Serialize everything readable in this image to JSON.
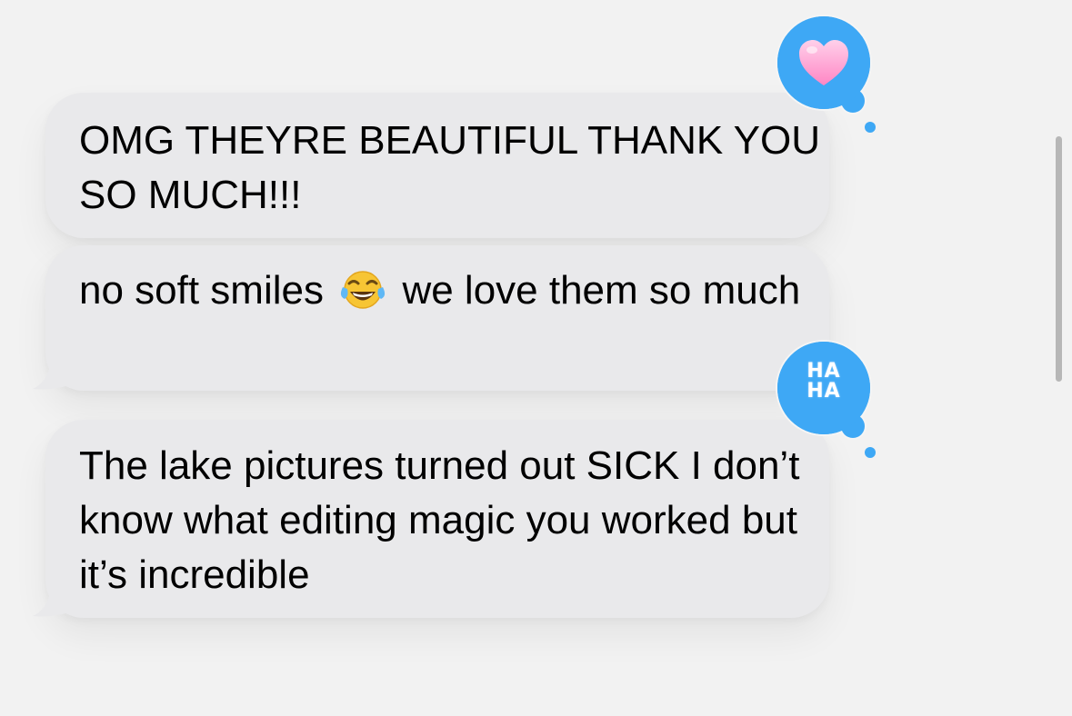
{
  "messages": [
    {
      "text": "OMG THEYRE BEAUTIFUL THANK YOU SO MUCH!!!",
      "tapback": "heart"
    },
    {
      "text_before_emoji": "no soft smiles",
      "emoji": "face-with-tears-of-joy-icon",
      "text_after_emoji": "we love them so much",
      "tapback": null
    },
    {
      "text": "The lake pictures turned out SICK I don’t know what editing magic you worked but it’s incredible",
      "tapback": "haha"
    }
  ],
  "tapbacks": {
    "haha_line1": "HA",
    "haha_line2": "HA"
  },
  "colors": {
    "bubble": "#e9e9eb",
    "tapback": "#3ea8f5",
    "heart": "#ff9ecf",
    "background": "#f2f2f2"
  }
}
